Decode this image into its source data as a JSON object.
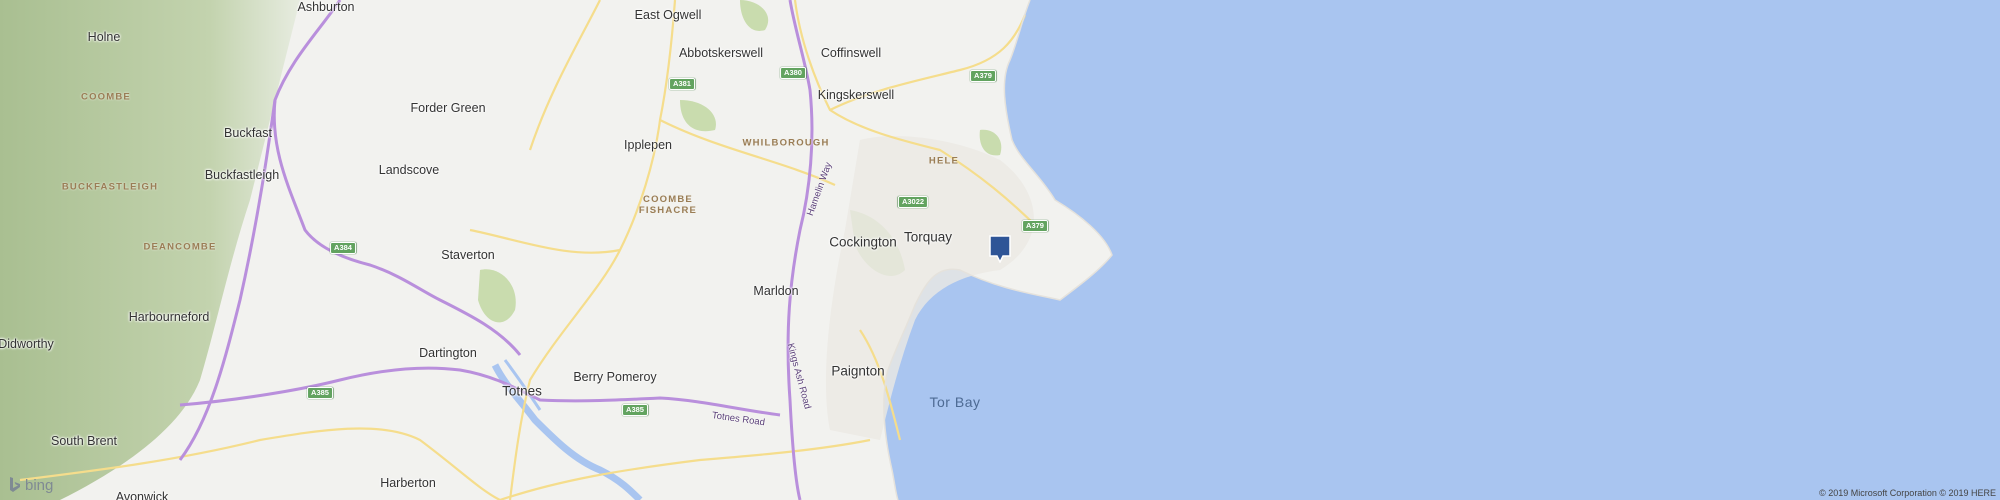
{
  "map": {
    "provider": "bing",
    "copyright": "© 2019 Microsoft Corporation © 2019 HERE",
    "places": [
      {
        "id": "ashburton",
        "label": "Ashburton"
      },
      {
        "id": "east-ogwell",
        "label": "East Ogwell"
      },
      {
        "id": "holne",
        "label": "Holne"
      },
      {
        "id": "abbotskerswell",
        "label": "Abbotskerswell"
      },
      {
        "id": "coffinswell",
        "label": "Coffinswell"
      },
      {
        "id": "kingskerswell",
        "label": "Kingskerswell"
      },
      {
        "id": "forder-green",
        "label": "Forder Green"
      },
      {
        "id": "buckfast",
        "label": "Buckfast"
      },
      {
        "id": "ipplepen",
        "label": "Ipplepen"
      },
      {
        "id": "buckfastleigh",
        "label": "Buckfastleigh"
      },
      {
        "id": "landscove",
        "label": "Landscove"
      },
      {
        "id": "cockington",
        "label": "Cockington"
      },
      {
        "id": "torquay",
        "label": "Torquay"
      },
      {
        "id": "staverton",
        "label": "Staverton"
      },
      {
        "id": "marldon",
        "label": "Marldon"
      },
      {
        "id": "harbourneford",
        "label": "Harbourneford"
      },
      {
        "id": "didworthy",
        "label": "Didworthy"
      },
      {
        "id": "dartington",
        "label": "Dartington"
      },
      {
        "id": "paignton",
        "label": "Paignton"
      },
      {
        "id": "berry-pomeroy",
        "label": "Berry Pomeroy"
      },
      {
        "id": "totnes",
        "label": "Totnes"
      },
      {
        "id": "south-brent",
        "label": "South Brent"
      },
      {
        "id": "avonwick",
        "label": "Avonwick"
      },
      {
        "id": "harberton",
        "label": "Harberton"
      }
    ],
    "areas": [
      {
        "id": "coombe",
        "label": "COOMBE"
      },
      {
        "id": "whilborough",
        "label": "WHILBOROUGH"
      },
      {
        "id": "hele",
        "label": "HELE"
      },
      {
        "id": "buckfastleigh-area",
        "label": "BUCKFASTLEIGH"
      },
      {
        "id": "coombe-fishacre",
        "label": "COOMBE FISHACRE"
      },
      {
        "id": "deancombe",
        "label": "DEANCOMBE"
      }
    ],
    "water": [
      {
        "id": "tor-bay",
        "label": "Tor Bay"
      }
    ],
    "road_shields": [
      {
        "id": "a381",
        "label": "A381"
      },
      {
        "id": "a380",
        "label": "A380"
      },
      {
        "id": "a379-north",
        "label": "A379"
      },
      {
        "id": "a3022",
        "label": "A3022"
      },
      {
        "id": "a379-south",
        "label": "A379"
      },
      {
        "id": "a384",
        "label": "A384"
      },
      {
        "id": "a385-west",
        "label": "A385"
      },
      {
        "id": "a385-east",
        "label": "A385"
      }
    ],
    "road_names": [
      {
        "id": "hamelin-way",
        "label": "Hamelin Way"
      },
      {
        "id": "kings-ash-road",
        "label": "Kings Ash Road"
      },
      {
        "id": "totnes-road",
        "label": "Totnes Road"
      }
    ],
    "marker": {
      "icon": "location-pin-icon",
      "color": "#2f5597"
    },
    "colors": {
      "sea": "#a9c5f0",
      "land": "#f2f2ef",
      "moor": "#bfd0aa",
      "park": "#c9dcae",
      "primary_road": "#b98fdc",
      "secondary_road": "#f5dd8c"
    }
  }
}
